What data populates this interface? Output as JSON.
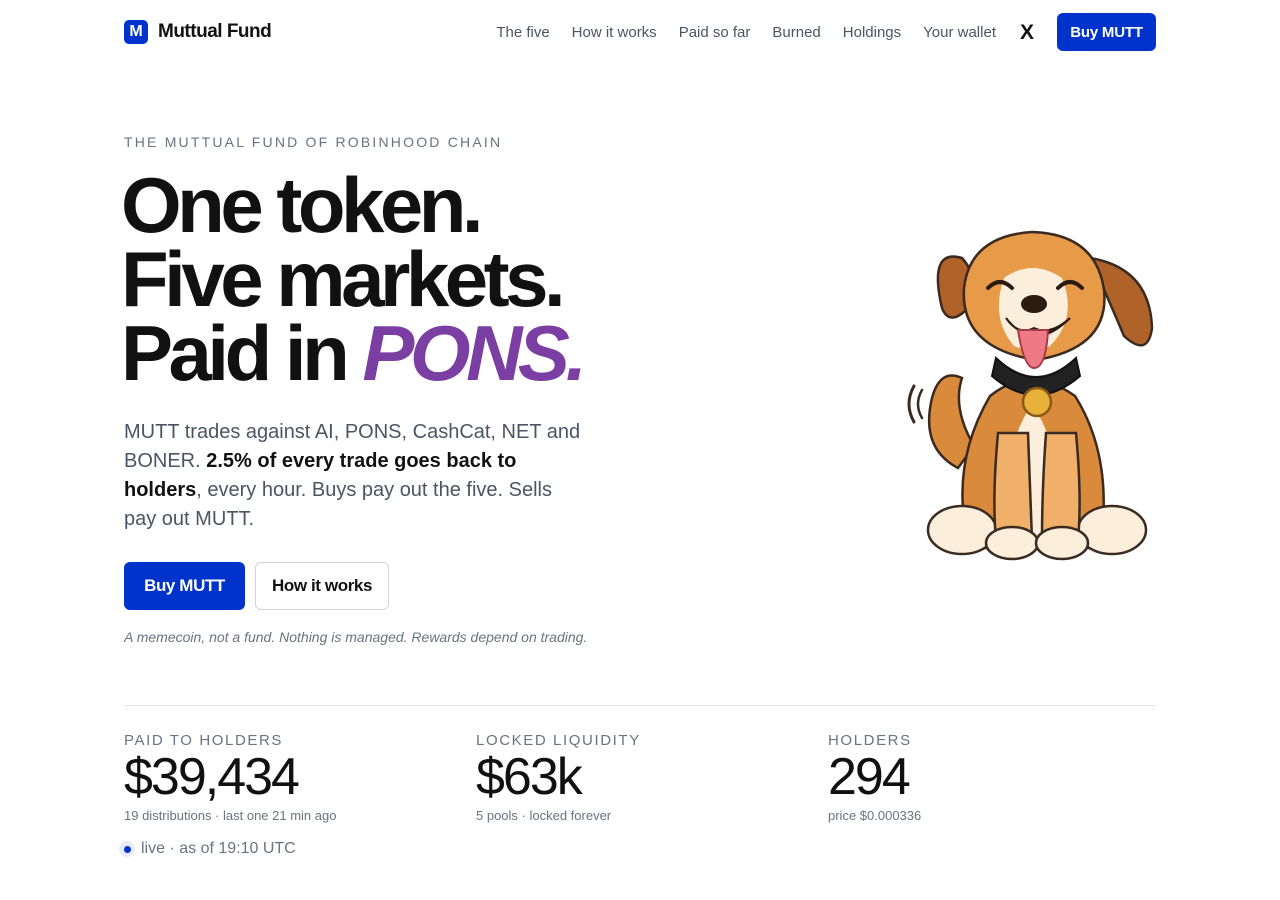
{
  "header": {
    "brand_letter": "M",
    "brand_name": "Muttual Fund",
    "nav": [
      "The five",
      "How it works",
      "Paid so far",
      "Burned",
      "Holdings",
      "Your wallet"
    ],
    "x_label": "X",
    "buy_label": "Buy MUTT"
  },
  "hero": {
    "eyebrow": "THE MUTTUAL FUND OF ROBINHOOD CHAIN",
    "headline_line1": "One token.",
    "headline_line2": "Five markets.",
    "headline_line3_prefix": "Paid in ",
    "headline_line3_accent": "PONS.",
    "lede_part1": "MUTT trades against AI, PONS, CashCat, NET and BONER. ",
    "lede_bold": "2.5% of every trade goes back to holders",
    "lede_part2": ", every hour. Buys pay out the five. Sells pay out MUTT.",
    "primary_cta": "Buy MUTT",
    "secondary_cta": "How it works",
    "disclaimer": "A memecoin, not a fund. Nothing is managed. Rewards depend on trading."
  },
  "stats": [
    {
      "label": "PAID TO HOLDERS",
      "value": "$39,434",
      "sub": "19 distributions · last one 21 min ago"
    },
    {
      "label": "LOCKED LIQUIDITY",
      "value": "$63k",
      "sub": "5 pools · locked forever"
    },
    {
      "label": "HOLDERS",
      "value": "294",
      "sub": "price $0.000336"
    }
  ],
  "live": {
    "text": "live · as of 19:10 UTC"
  },
  "colors": {
    "accent_blue": "#0033cc",
    "accent_purple": "#7b3fa3",
    "muted": "#6b7280"
  }
}
